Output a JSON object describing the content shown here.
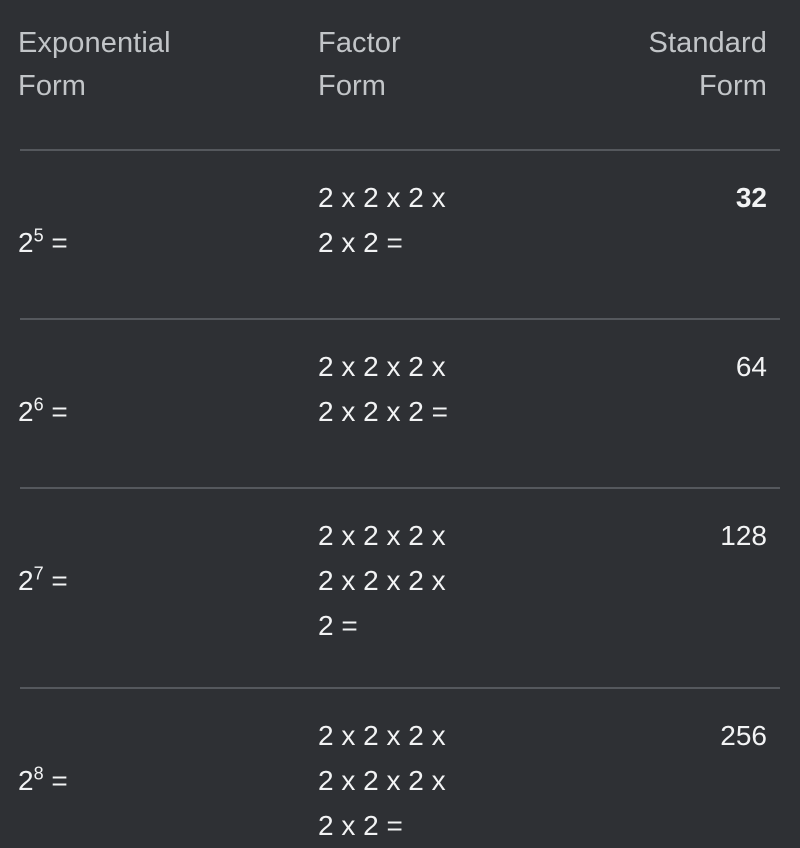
{
  "table": {
    "headers": {
      "exponential": "Exponential\nForm",
      "factor": "Factor\nForm",
      "standard": "Standard\nForm"
    },
    "colors": {
      "background": "#2e3034",
      "header_text": "#c2c5c8",
      "body_text": "#f2f3f4",
      "divider": "#55585d"
    },
    "rows": [
      {
        "exponential_base": "2",
        "exponential_power": "5",
        "exponential_equals": " =",
        "exponential_full": "2^5 =",
        "factor": "2 x 2 x 2 x\n2 x 2 =",
        "standard": "32",
        "standard_bold": true
      },
      {
        "exponential_base": "2",
        "exponential_power": "6",
        "exponential_equals": " =",
        "exponential_full": "2^6 =",
        "factor": "2 x 2 x 2 x\n2 x 2 x 2 =",
        "standard": "64",
        "standard_bold": false
      },
      {
        "exponential_base": "2",
        "exponential_power": "7",
        "exponential_equals": " =",
        "exponential_full": "2^7 =",
        "factor": "2 x 2 x 2 x\n2 x 2 x 2 x\n2 =",
        "standard": "128",
        "standard_bold": false
      },
      {
        "exponential_base": "2",
        "exponential_power": "8",
        "exponential_equals": " =",
        "exponential_full": "2^8 =",
        "factor": "2 x 2 x 2 x\n2 x 2 x 2 x\n2 x 2 =",
        "standard": "256",
        "standard_bold": false
      }
    ]
  }
}
